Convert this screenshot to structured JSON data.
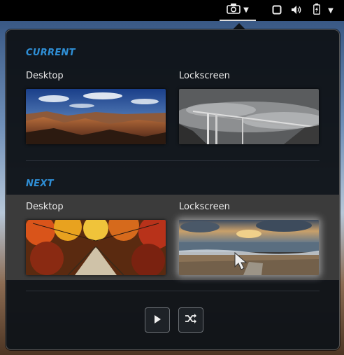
{
  "topbar": {
    "icons": [
      "camera-icon",
      "dropdown-caret-icon",
      "display-icon",
      "volume-icon",
      "battery-charging-icon",
      "chevron-down-icon"
    ]
  },
  "popover": {
    "current_title": "CURRENT",
    "next_title": "NEXT",
    "current": {
      "desktop_label": "Desktop",
      "lockscreen_label": "Lockscreen"
    },
    "next": {
      "desktop_label": "Desktop",
      "lockscreen_label": "Lockscreen"
    },
    "controls": {
      "play_icon": "play-icon",
      "shuffle_icon": "shuffle-icon"
    }
  },
  "colors": {
    "accent": "#2f8fd6",
    "popover_bg": "#101419",
    "next_band": "#3b3b3b"
  }
}
